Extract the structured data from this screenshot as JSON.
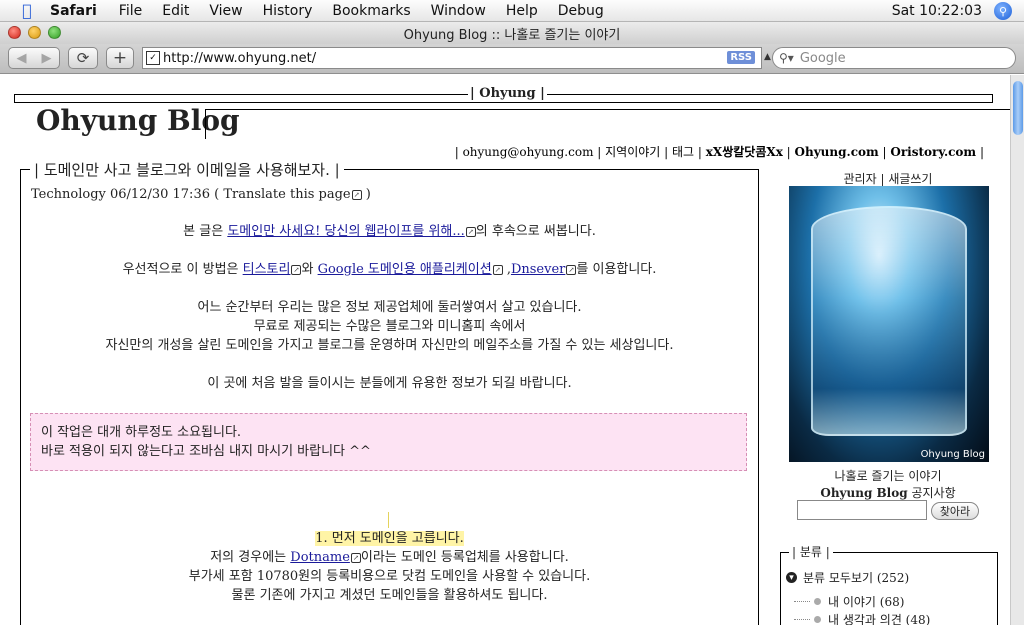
{
  "menubar": {
    "app": "Safari",
    "items": [
      "File",
      "Edit",
      "View",
      "History",
      "Bookmarks",
      "Window",
      "Help",
      "Debug"
    ],
    "clock": "Sat 10:22:03"
  },
  "window": {
    "title": "Ohyung Blog :: 나홀로 즐기는 이야기"
  },
  "toolbar": {
    "url": "http://www.ohyung.net/",
    "rss": "RSS",
    "search_placeholder": "Google"
  },
  "page": {
    "site_id": "| Ohyung |",
    "blog_title": "Ohyung Blog",
    "topnav": [
      {
        "label": "ohyung@ohyung.com",
        "bold": false
      },
      {
        "label": "지역이야기",
        "bold": false
      },
      {
        "label": "태그",
        "bold": false
      },
      {
        "label": "xX쌍칼닷콤Xx",
        "bold": true
      },
      {
        "label": "Ohyung.com",
        "bold": true
      },
      {
        "label": "Oristory.com",
        "bold": true
      }
    ],
    "post": {
      "title": "| 도메인만 사고 블로그와 이메일을 사용해보자. |",
      "meta_category": "Technology",
      "meta_date": "06/12/30 17:36",
      "meta_translate": "( Translate this page",
      "meta_close": ")",
      "p1_pre": "본 글은",
      "p1_link": "도메인만 사세요! 당신의 웹라이프를 위해...",
      "p1_post": "의 후속으로 써봅니다.",
      "p2_pre": "우선적으로 이 방법은",
      "p2_link1": "티스토리",
      "p2_mid1": "와",
      "p2_link2": "Google 도메인용 애플리케이션",
      "p2_mid2": ",",
      "p2_link3": "Dnsever",
      "p2_post": "를 이용합니다.",
      "p3_l1": "어느 순간부터 우리는 많은 정보 제공업체에 둘러쌓여서 살고 있습니다.",
      "p3_l2": "무료로 제공되는 수많은 블로그와 미니홈피 속에서",
      "p3_l3": "자신만의 개성을 살린 도메인을 가지고 블로그를 운영하며 자신만의 메일주소를 가질 수 있는 세상입니다.",
      "p4": "이 곳에 처음 발을 들이시는 분들에게 유용한 정보가 되길 바랍니다.",
      "notice_l1": "이 작업은 대개 하루정도 소요됩니다.",
      "notice_l2": "바로 적용이 되지 않는다고 조바심 내지 마시기 바랍니다 ^^",
      "step1": "1. 먼저 도메인을 고릅니다.",
      "s1_pre": "저의 경우에는",
      "s1_link": "Dotname",
      "s1_post": "이라는 도메인 등록업체를 사용합니다.",
      "s1_l2": "부가세 포함 10780원의 등록비용으로 닷컴 도메인을 사용할 수 있습니다.",
      "s1_l3": "물론 기존에 가지고 계셨던 도메인들을 활용하셔도 됩니다."
    },
    "sidebar": {
      "admin": "관리자",
      "write": "새글쓰기",
      "photo_caption": "Ohyung Blog",
      "tagline": "나홀로 즐기는 이야기",
      "notice_blog": "Ohyung Blog",
      "notice_label": "공지사항",
      "search_button": "찾아라",
      "category_title": "| 분류 |",
      "category_root": "분류 모두보기 (252)",
      "categories": [
        "내 이야기 (68)",
        "내 생각과 의견 (48)"
      ]
    }
  }
}
